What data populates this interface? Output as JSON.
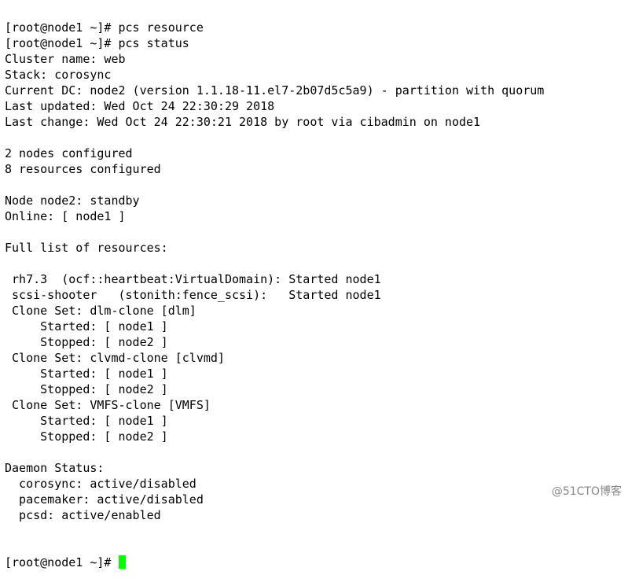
{
  "terminal": {
    "lines": [
      "[root@node1 ~]# pcs resource ",
      "[root@node1 ~]# pcs status",
      "Cluster name: web",
      "Stack: corosync",
      "Current DC: node2 (version 1.1.18-11.el7-2b07d5c5a9) - partition with quorum",
      "Last updated: Wed Oct 24 22:30:29 2018",
      "Last change: Wed Oct 24 22:30:21 2018 by root via cibadmin on node1",
      "",
      "2 nodes configured",
      "8 resources configured",
      "",
      "Node node2: standby",
      "Online: [ node1 ]",
      "",
      "Full list of resources:",
      "",
      " rh7.3  (ocf::heartbeat:VirtualDomain): Started node1",
      " scsi-shooter   (stonith:fence_scsi):   Started node1",
      " Clone Set: dlm-clone [dlm]",
      "     Started: [ node1 ]",
      "     Stopped: [ node2 ]",
      " Clone Set: clvmd-clone [clvmd]",
      "     Started: [ node1 ]",
      "     Stopped: [ node2 ]",
      " Clone Set: VMFS-clone [VMFS]",
      "     Started: [ node1 ]",
      "     Stopped: [ node2 ]",
      "",
      "Daemon Status:",
      "  corosync: active/disabled",
      "  pacemaker: active/disabled",
      "  pcsd: active/enabled"
    ],
    "prompt": "[root@node1 ~]# ",
    "cursor_color": "#00ff00"
  },
  "watermark": "@51CTO博客"
}
